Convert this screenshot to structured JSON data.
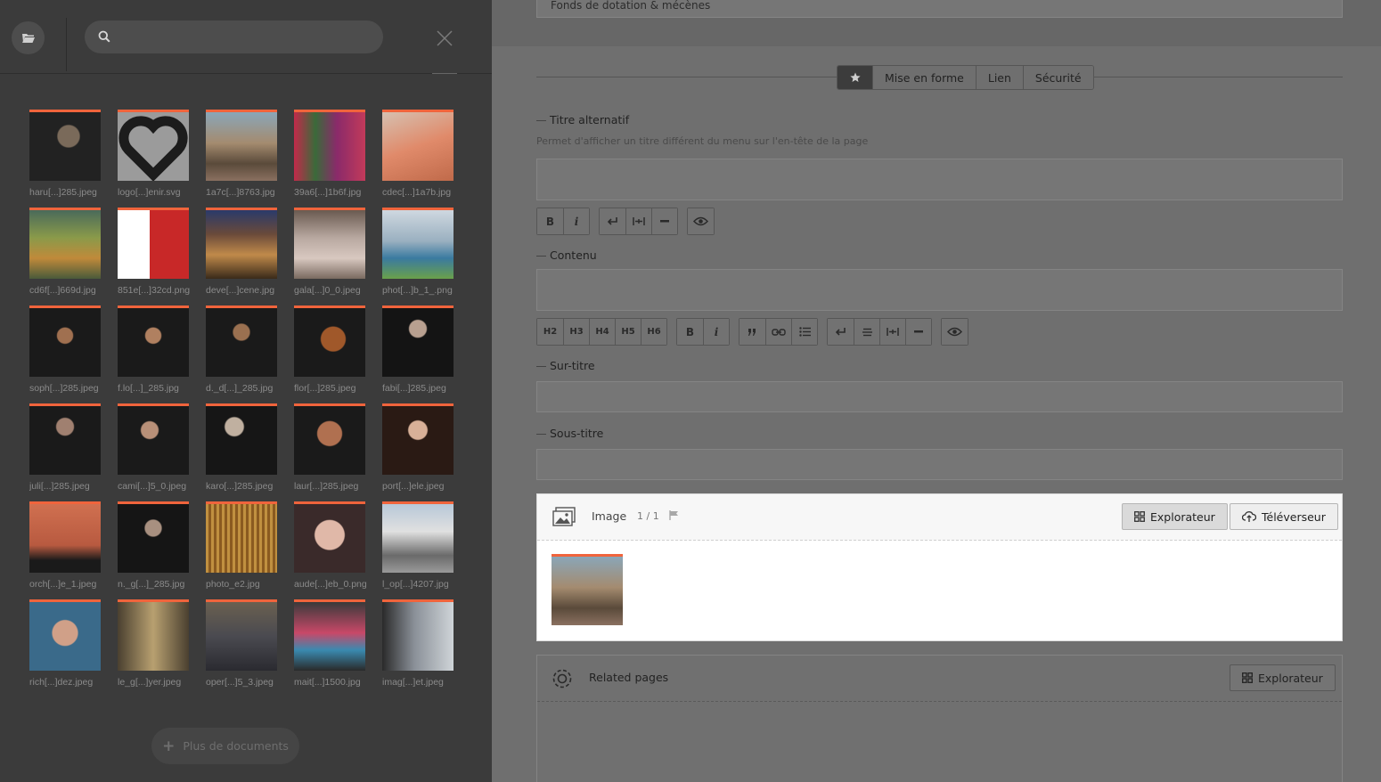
{
  "drawer": {
    "search": {
      "placeholder": ""
    },
    "more_button_label": "Plus de documents",
    "documents": [
      {
        "label": "haru[...]285.jpeg"
      },
      {
        "label": "logo[...]enir.svg"
      },
      {
        "label": "1a7c[...]8763.jpg"
      },
      {
        "label": "39a6[...]1b6f.jpg"
      },
      {
        "label": "cdec[...]1a7b.jpg"
      },
      {
        "label": "cd6f[...]669d.jpg"
      },
      {
        "label": "851e[...]32cd.png"
      },
      {
        "label": "deve[...]cene.jpg"
      },
      {
        "label": "gala[...]0_0.jpeg"
      },
      {
        "label": "phot[...]b_1_.png"
      },
      {
        "label": "soph[...]285.jpeg"
      },
      {
        "label": "f.lo[...]_285.jpg"
      },
      {
        "label": "d._d[...]_285.jpg"
      },
      {
        "label": "flor[...]285.jpeg"
      },
      {
        "label": "fabi[...]285.jpeg"
      },
      {
        "label": "juli[...]285.jpeg"
      },
      {
        "label": "cami[...]5_0.jpeg"
      },
      {
        "label": "karo[...]285.jpeg"
      },
      {
        "label": "laur[...]285.jpeg"
      },
      {
        "label": "port[...]ele.jpeg"
      },
      {
        "label": "orch[...]e_1.jpeg"
      },
      {
        "label": "n._g[...]_285.jpg"
      },
      {
        "label": "photo_e2.jpg"
      },
      {
        "label": "aude[...]eb_0.png"
      },
      {
        "label": "l_op[...]4207.jpg"
      },
      {
        "label": "rich[...]dez.jpeg"
      },
      {
        "label": "le_g[...]yer.jpeg"
      },
      {
        "label": "oper[...]5_3.jpeg"
      },
      {
        "label": "mait[...]1500.jpg"
      },
      {
        "label": "imag[...]et.jpeg"
      }
    ]
  },
  "editor": {
    "top_field_value": "Fonds de dotation & mécènes",
    "tabs": [
      "Mise en forme",
      "Lien",
      "Sécurité"
    ],
    "fields": {
      "alt_title": {
        "label": "Titre alternatif",
        "help": "Permet d'afficher un titre différent du menu sur l'en-tête de la page"
      },
      "content": {
        "label": "Contenu"
      },
      "surtitle": {
        "label": "Sur-titre"
      },
      "subtitle": {
        "label": "Sous-titre"
      }
    },
    "toolbar_headings": [
      "H2",
      "H3",
      "H4",
      "H5",
      "H6"
    ],
    "bold": "B",
    "italic": "i",
    "image_block": {
      "title": "Image",
      "count": "1 / 1",
      "explorer_label": "Explorateur",
      "upload_label": "Téléverseur"
    },
    "related_block": {
      "title": "Related pages",
      "explorer_label": "Explorateur"
    }
  }
}
